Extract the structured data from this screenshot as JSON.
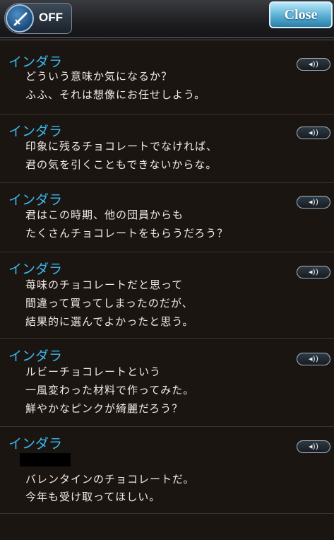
{
  "topbar": {
    "toggle_label": "OFF",
    "toggle_icon": "sword-icon",
    "close_label": "Close"
  },
  "voice_button_glyph": "◂))",
  "messages": [
    {
      "speaker": "インダラ",
      "lines": [
        "どういう意味か気になるか？",
        "ふふ、それは想像にお任せしよう。"
      ]
    },
    {
      "speaker": "インダラ",
      "lines": [
        "印象に残るチョコレートでなければ、",
        "君の気を引くこともできないからな。"
      ]
    },
    {
      "speaker": "インダラ",
      "lines": [
        "君はこの時期、他の団員からも",
        "たくさんチョコレートをもらうだろう？"
      ]
    },
    {
      "speaker": "インダラ",
      "lines": [
        "苺味のチョコレートだと思って",
        "間違って買ってしまったのだが、",
        "結果的に選んでよかったと思う。"
      ]
    },
    {
      "speaker": "インダラ",
      "lines": [
        "ルビーチョコレートという",
        "一風変わった材料で作ってみた。",
        "鮮やかなピンクが綺麗だろう？"
      ]
    },
    {
      "speaker": "インダラ",
      "lines": [
        "バレンタインのチョコレートだ。",
        "今年も受け取ってほしい。"
      ]
    }
  ],
  "colors": {
    "speaker": "#39b8ee",
    "text": "#f1ece6",
    "background": "#1b1512"
  }
}
